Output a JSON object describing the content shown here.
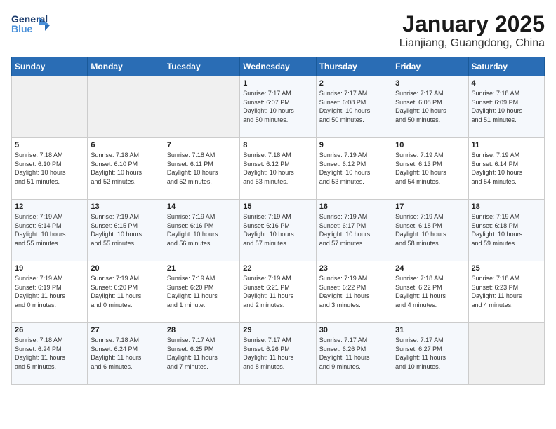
{
  "logo": {
    "line1": "General",
    "line2": "Blue"
  },
  "title": "January 2025",
  "subtitle": "Lianjiang, Guangdong, China",
  "weekdays": [
    "Sunday",
    "Monday",
    "Tuesday",
    "Wednesday",
    "Thursday",
    "Friday",
    "Saturday"
  ],
  "weeks": [
    [
      {
        "day": "",
        "info": ""
      },
      {
        "day": "",
        "info": ""
      },
      {
        "day": "",
        "info": ""
      },
      {
        "day": "1",
        "info": "Sunrise: 7:17 AM\nSunset: 6:07 PM\nDaylight: 10 hours\nand 50 minutes."
      },
      {
        "day": "2",
        "info": "Sunrise: 7:17 AM\nSunset: 6:08 PM\nDaylight: 10 hours\nand 50 minutes."
      },
      {
        "day": "3",
        "info": "Sunrise: 7:17 AM\nSunset: 6:08 PM\nDaylight: 10 hours\nand 50 minutes."
      },
      {
        "day": "4",
        "info": "Sunrise: 7:18 AM\nSunset: 6:09 PM\nDaylight: 10 hours\nand 51 minutes."
      }
    ],
    [
      {
        "day": "5",
        "info": "Sunrise: 7:18 AM\nSunset: 6:10 PM\nDaylight: 10 hours\nand 51 minutes."
      },
      {
        "day": "6",
        "info": "Sunrise: 7:18 AM\nSunset: 6:10 PM\nDaylight: 10 hours\nand 52 minutes."
      },
      {
        "day": "7",
        "info": "Sunrise: 7:18 AM\nSunset: 6:11 PM\nDaylight: 10 hours\nand 52 minutes."
      },
      {
        "day": "8",
        "info": "Sunrise: 7:18 AM\nSunset: 6:12 PM\nDaylight: 10 hours\nand 53 minutes."
      },
      {
        "day": "9",
        "info": "Sunrise: 7:19 AM\nSunset: 6:12 PM\nDaylight: 10 hours\nand 53 minutes."
      },
      {
        "day": "10",
        "info": "Sunrise: 7:19 AM\nSunset: 6:13 PM\nDaylight: 10 hours\nand 54 minutes."
      },
      {
        "day": "11",
        "info": "Sunrise: 7:19 AM\nSunset: 6:14 PM\nDaylight: 10 hours\nand 54 minutes."
      }
    ],
    [
      {
        "day": "12",
        "info": "Sunrise: 7:19 AM\nSunset: 6:14 PM\nDaylight: 10 hours\nand 55 minutes."
      },
      {
        "day": "13",
        "info": "Sunrise: 7:19 AM\nSunset: 6:15 PM\nDaylight: 10 hours\nand 55 minutes."
      },
      {
        "day": "14",
        "info": "Sunrise: 7:19 AM\nSunset: 6:16 PM\nDaylight: 10 hours\nand 56 minutes."
      },
      {
        "day": "15",
        "info": "Sunrise: 7:19 AM\nSunset: 6:16 PM\nDaylight: 10 hours\nand 57 minutes."
      },
      {
        "day": "16",
        "info": "Sunrise: 7:19 AM\nSunset: 6:17 PM\nDaylight: 10 hours\nand 57 minutes."
      },
      {
        "day": "17",
        "info": "Sunrise: 7:19 AM\nSunset: 6:18 PM\nDaylight: 10 hours\nand 58 minutes."
      },
      {
        "day": "18",
        "info": "Sunrise: 7:19 AM\nSunset: 6:18 PM\nDaylight: 10 hours\nand 59 minutes."
      }
    ],
    [
      {
        "day": "19",
        "info": "Sunrise: 7:19 AM\nSunset: 6:19 PM\nDaylight: 11 hours\nand 0 minutes."
      },
      {
        "day": "20",
        "info": "Sunrise: 7:19 AM\nSunset: 6:20 PM\nDaylight: 11 hours\nand 0 minutes."
      },
      {
        "day": "21",
        "info": "Sunrise: 7:19 AM\nSunset: 6:20 PM\nDaylight: 11 hours\nand 1 minute."
      },
      {
        "day": "22",
        "info": "Sunrise: 7:19 AM\nSunset: 6:21 PM\nDaylight: 11 hours\nand 2 minutes."
      },
      {
        "day": "23",
        "info": "Sunrise: 7:19 AM\nSunset: 6:22 PM\nDaylight: 11 hours\nand 3 minutes."
      },
      {
        "day": "24",
        "info": "Sunrise: 7:18 AM\nSunset: 6:22 PM\nDaylight: 11 hours\nand 4 minutes."
      },
      {
        "day": "25",
        "info": "Sunrise: 7:18 AM\nSunset: 6:23 PM\nDaylight: 11 hours\nand 4 minutes."
      }
    ],
    [
      {
        "day": "26",
        "info": "Sunrise: 7:18 AM\nSunset: 6:24 PM\nDaylight: 11 hours\nand 5 minutes."
      },
      {
        "day": "27",
        "info": "Sunrise: 7:18 AM\nSunset: 6:24 PM\nDaylight: 11 hours\nand 6 minutes."
      },
      {
        "day": "28",
        "info": "Sunrise: 7:17 AM\nSunset: 6:25 PM\nDaylight: 11 hours\nand 7 minutes."
      },
      {
        "day": "29",
        "info": "Sunrise: 7:17 AM\nSunset: 6:26 PM\nDaylight: 11 hours\nand 8 minutes."
      },
      {
        "day": "30",
        "info": "Sunrise: 7:17 AM\nSunset: 6:26 PM\nDaylight: 11 hours\nand 9 minutes."
      },
      {
        "day": "31",
        "info": "Sunrise: 7:17 AM\nSunset: 6:27 PM\nDaylight: 11 hours\nand 10 minutes."
      },
      {
        "day": "",
        "info": ""
      }
    ]
  ]
}
